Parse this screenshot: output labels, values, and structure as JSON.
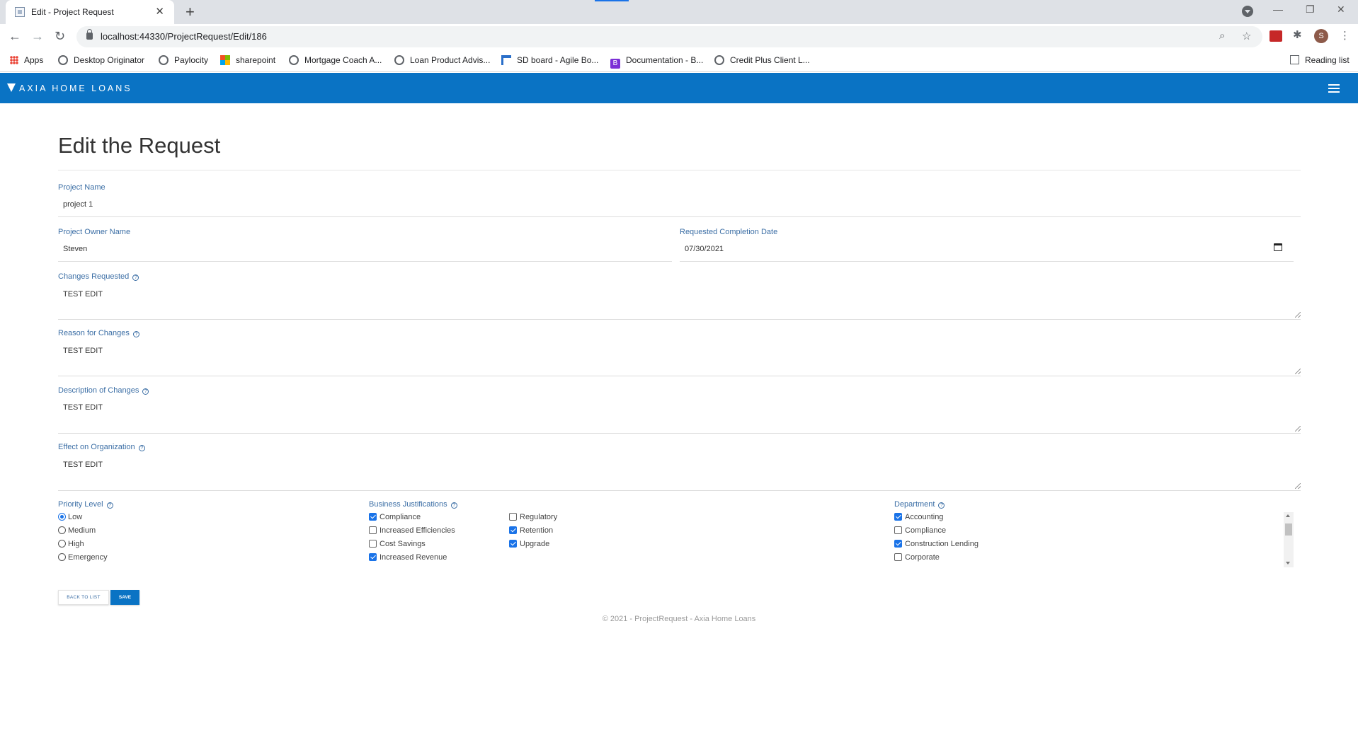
{
  "browser": {
    "tab_title": "Edit - Project Request",
    "url": "localhost:44330/ProjectRequest/Edit/186",
    "bookmarks": [
      {
        "label": "Apps",
        "icon": "apps-grid-icon"
      },
      {
        "label": "Desktop Originator",
        "icon": "globe-icon"
      },
      {
        "label": "Paylocity",
        "icon": "globe-icon"
      },
      {
        "label": "sharepoint",
        "icon": "microsoft-icon"
      },
      {
        "label": "Mortgage Coach A...",
        "icon": "globe-icon"
      },
      {
        "label": "Loan Product Advis...",
        "icon": "globe-icon"
      },
      {
        "label": "SD board - Agile Bo...",
        "icon": "flag-icon"
      },
      {
        "label": "Documentation - B...",
        "icon": "b-icon"
      },
      {
        "label": "Credit Plus Client L...",
        "icon": "globe-icon"
      }
    ],
    "reading_list": "Reading list",
    "avatar_letter": "S"
  },
  "app": {
    "brand": "AXIA HOME LOANS",
    "brand_color": "#0a73c4"
  },
  "form": {
    "title": "Edit the Request",
    "project_name": {
      "label": "Project Name",
      "value": "project 1"
    },
    "owner_name": {
      "label": "Project Owner Name",
      "value": "Steven"
    },
    "completion_date": {
      "label": "Requested Completion Date",
      "value": "07/30/2021"
    },
    "changes_requested": {
      "label": "Changes Requested",
      "value": "TEST EDIT"
    },
    "reason_for_changes": {
      "label": "Reason for Changes",
      "value": "TEST EDIT"
    },
    "description_of_changes": {
      "label": "Description of Changes",
      "value": "TEST EDIT"
    },
    "effect_on_organization": {
      "label": "Effect on Organization",
      "value": "TEST EDIT"
    },
    "priority": {
      "label": "Priority Level",
      "options": [
        {
          "label": "Low",
          "selected": true
        },
        {
          "label": "Medium",
          "selected": false
        },
        {
          "label": "High",
          "selected": false
        },
        {
          "label": "Emergency",
          "selected": false
        }
      ]
    },
    "justifications": {
      "label": "Business Justifications",
      "options": [
        {
          "label": "Compliance",
          "checked": true
        },
        {
          "label": "Increased Efficiencies",
          "checked": false
        },
        {
          "label": "Cost Savings",
          "checked": false
        },
        {
          "label": "Increased Revenue",
          "checked": true
        },
        {
          "label": "Regulatory",
          "checked": false
        },
        {
          "label": "Retention",
          "checked": true
        },
        {
          "label": "Upgrade",
          "checked": true
        }
      ]
    },
    "department": {
      "label": "Department",
      "options": [
        {
          "label": "Accounting",
          "checked": true
        },
        {
          "label": "Compliance",
          "checked": false
        },
        {
          "label": "Construction Lending",
          "checked": true
        },
        {
          "label": "Corporate",
          "checked": false
        }
      ]
    },
    "back_label": "BACK TO LIST",
    "save_label": "SAVE"
  },
  "footer": "© 2021 - ProjectRequest - Axia Home Loans"
}
